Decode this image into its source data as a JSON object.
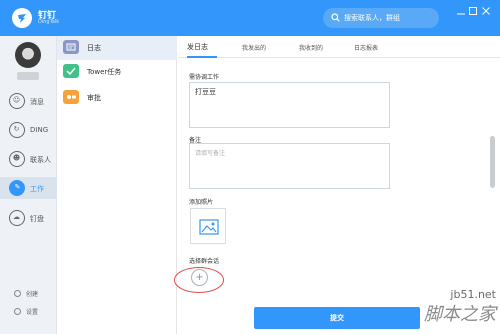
{
  "app": {
    "name": "钉钉",
    "subtitle": "DingTalk",
    "brand_color": "#3296fa",
    "search_placeholder": "搜索联系人，群组",
    "search_icon": "search-icon",
    "window_controls": [
      "minimize-icon",
      "maximize-icon",
      "close-icon"
    ]
  },
  "nav": {
    "items": [
      {
        "label": "消息",
        "icon": "message-icon",
        "glyph": "☺",
        "active": false
      },
      {
        "label": "DING",
        "icon": "ding-icon",
        "glyph": "↻",
        "active": false
      },
      {
        "label": "联系人",
        "icon": "contacts-icon",
        "glyph": "☻",
        "active": false
      },
      {
        "label": "工作",
        "icon": "work-icon",
        "glyph": "✎",
        "active": true
      },
      {
        "label": "钉盘",
        "icon": "cloud-disk-icon",
        "glyph": "☁",
        "active": false
      }
    ],
    "bottom": [
      {
        "label": "创建",
        "icon": "create-icon"
      },
      {
        "label": "设置",
        "icon": "settings-icon"
      }
    ]
  },
  "apps": {
    "items": [
      {
        "label": "日志",
        "icon": "log-icon",
        "color": "#8a97c7",
        "active": true
      },
      {
        "label": "Tower任务",
        "icon": "task-check-icon",
        "color": "#40c288",
        "active": false
      },
      {
        "label": "审批",
        "icon": "approval-icon",
        "color": "#f6a23a",
        "active": false
      }
    ]
  },
  "tabs": [
    "发日志",
    "我发出的",
    "我收到的",
    "日志报表"
  ],
  "form": {
    "coordination_label": "需协调工作",
    "coordination_value": "打豆豆",
    "note_label": "备注",
    "note_placeholder": "请填写备注",
    "photo_label": "添加照片",
    "photo_icon": "image-icon",
    "group_label": "选择群会话",
    "group_add_symbol": "+",
    "submit_label": "提交"
  },
  "watermark": {
    "url": "jb51.net",
    "text": "脚本之家"
  }
}
